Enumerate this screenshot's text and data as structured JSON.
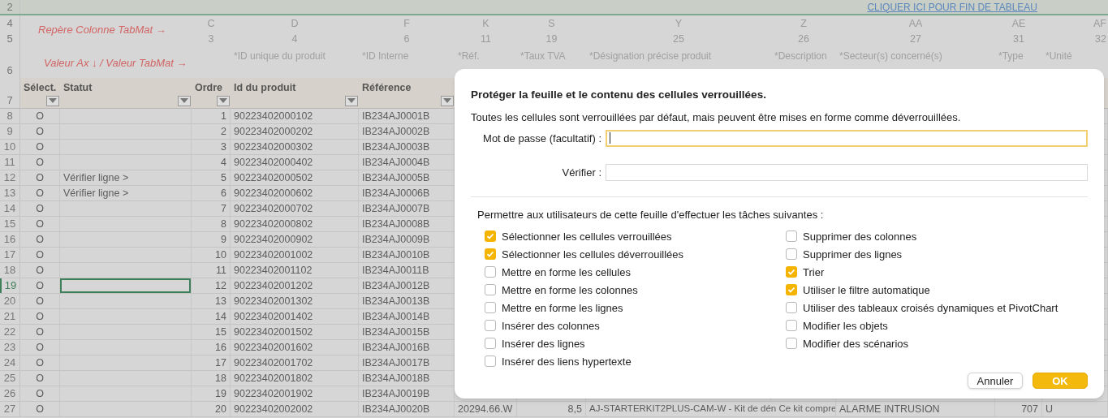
{
  "sheet": {
    "link": "CLIQUER ICI POUR FIN DE TABLEAU",
    "row_numbers": {
      "link_row": "2",
      "letters_row": "4",
      "numbers_row": "5",
      "titles_row": "6",
      "header_row": "7"
    },
    "letters_label": "Repère  Colonne  TabMat →",
    "titles_label": "Valeur  Ax  ↓  /  Valeur  TabMat  →",
    "columns": [
      {
        "header": "Sélect.",
        "filter": true
      },
      {
        "header": "Statut",
        "filter": true
      },
      {
        "letter": "C",
        "number": "3",
        "header": "Ordre",
        "filter": true
      },
      {
        "letter": "D",
        "number": "4",
        "title": "*ID unique du produit",
        "header": "Id du produit",
        "filter": true
      },
      {
        "letter": "F",
        "number": "6",
        "title": "*ID Interne",
        "header": "Référence",
        "filter": true
      },
      {
        "letter": "K",
        "number": "11",
        "title": "*Réf."
      },
      {
        "letter": "S",
        "number": "19",
        "title": "*Taux TVA"
      },
      {
        "letter": "Y",
        "number": "25",
        "title": "*Désignation précise produit"
      },
      {
        "letter": "Z",
        "number": "26",
        "title": "*Description"
      },
      {
        "letter": "AA",
        "number": "27",
        "title": "*Secteur(s) concerné(s)"
      },
      {
        "letter": "AE",
        "number": "31",
        "title": "*Type"
      },
      {
        "letter": "AF",
        "number": "32",
        "title": "*Unité"
      }
    ],
    "rows": [
      {
        "number": "8",
        "select": "O",
        "order": "1",
        "id": "90223402000102",
        "reference": "IB234AJ0001B",
        "selected": false
      },
      {
        "number": "9",
        "select": "O",
        "order": "2",
        "id": "90223402000202",
        "reference": "IB234AJ0002B",
        "selected": false
      },
      {
        "number": "10",
        "select": "O",
        "order": "3",
        "id": "90223402000302",
        "reference": "IB234AJ0003B",
        "selected": false
      },
      {
        "number": "11",
        "select": "O",
        "order": "4",
        "id": "90223402000402",
        "reference": "IB234AJ0004B",
        "selected": false
      },
      {
        "number": "12",
        "select": "O",
        "status": "Vérifier ligne >",
        "order": "5",
        "id": "90223402000502",
        "reference": "IB234AJ0005B",
        "selected": false
      },
      {
        "number": "13",
        "select": "O",
        "status": "Vérifier ligne >",
        "order": "6",
        "id": "90223402000602",
        "reference": "IB234AJ0006B",
        "selected": false
      },
      {
        "number": "14",
        "select": "O",
        "order": "7",
        "id": "90223402000702",
        "reference": "IB234AJ0007B",
        "selected": false
      },
      {
        "number": "15",
        "select": "O",
        "order": "8",
        "id": "90223402000802",
        "reference": "IB234AJ0008B",
        "selected": false
      },
      {
        "number": "16",
        "select": "O",
        "order": "9",
        "id": "90223402000902",
        "reference": "IB234AJ0009B",
        "selected": false
      },
      {
        "number": "17",
        "select": "O",
        "order": "10",
        "id": "90223402001002",
        "reference": "IB234AJ0010B",
        "selected": false
      },
      {
        "number": "18",
        "select": "O",
        "order": "11",
        "id": "90223402001102",
        "reference": "IB234AJ0011B",
        "selected": false
      },
      {
        "number": "19",
        "select": "O",
        "order": "12",
        "id": "90223402001202",
        "reference": "IB234AJ0012B",
        "selected": true
      },
      {
        "number": "20",
        "select": "O",
        "order": "13",
        "id": "90223402001302",
        "reference": "IB234AJ0013B",
        "selected": false
      },
      {
        "number": "21",
        "select": "O",
        "order": "14",
        "id": "90223402001402",
        "reference": "IB234AJ0014B",
        "selected": false
      },
      {
        "number": "22",
        "select": "O",
        "order": "15",
        "id": "90223402001502",
        "reference": "IB234AJ0015B",
        "selected": false
      },
      {
        "number": "23",
        "select": "O",
        "order": "16",
        "id": "90223402001602",
        "reference": "IB234AJ0016B",
        "selected": false
      },
      {
        "number": "24",
        "select": "O",
        "order": "17",
        "id": "90223402001702",
        "reference": "IB234AJ0017B",
        "selected": false
      },
      {
        "number": "25",
        "select": "O",
        "order": "18",
        "id": "90223402001802",
        "reference": "IB234AJ0018B",
        "selected": false
      },
      {
        "number": "26",
        "select": "O",
        "order": "19",
        "id": "90223402001902",
        "reference": "IB234AJ0019B",
        "selected": false
      },
      {
        "number": "27",
        "select": "O",
        "order": "20",
        "id": "90223402002002",
        "reference": "IB234AJ0020B",
        "selected": false,
        "tail": {
          "K": "20294.66.W",
          "S": "8,5",
          "Y": "AJ-STARTERKIT2PLUS-CAM-W - Kit de dén Ce kit compre",
          "AA": "ALARME INTRUSION",
          "AE": "707",
          "AF": "U"
        }
      }
    ]
  },
  "dialog": {
    "title": "Protéger la feuille et le contenu des cellules verrouillées.",
    "description": "Toutes les cellules sont verrouillées par défaut, mais peuvent être mises en forme comme déverrouillées.",
    "password": {
      "label": "Mot de passe (facultatif) :",
      "focused": true
    },
    "verify": {
      "label": "Vérifier :",
      "focused": false
    },
    "permissions_label": "Permettre aux utilisateurs de cette feuille d'effectuer les tâches suivantes :",
    "option_columns": [
      [
        {
          "label": "Sélectionner les cellules verrouillées",
          "checked": true
        },
        {
          "label": "Sélectionner les cellules déverrouillées",
          "checked": true
        },
        {
          "label": "Mettre en forme les cellules",
          "checked": false
        },
        {
          "label": "Mettre en forme les colonnes",
          "checked": false
        },
        {
          "label": "Mettre en forme les lignes",
          "checked": false
        },
        {
          "label": "Insérer des colonnes",
          "checked": false
        },
        {
          "label": "Insérer des lignes",
          "checked": false
        },
        {
          "label": "Insérer des liens hypertexte",
          "checked": false
        }
      ],
      [
        {
          "label": "Supprimer des colonnes",
          "checked": false
        },
        {
          "label": "Supprimer des lignes",
          "checked": false
        },
        {
          "label": "Trier",
          "checked": true
        },
        {
          "label": "Utiliser le filtre automatique",
          "checked": true
        },
        {
          "label": "Utiliser des tableaux croisés dynamiques et PivotChart",
          "checked": false
        },
        {
          "label": "Modifier les objets",
          "checked": false
        },
        {
          "label": "Modifier des scénarios",
          "checked": false
        }
      ]
    ],
    "buttons": [
      {
        "label": "Annuler",
        "kind": "secondary"
      },
      {
        "label": "OK",
        "kind": "primary"
      }
    ]
  }
}
